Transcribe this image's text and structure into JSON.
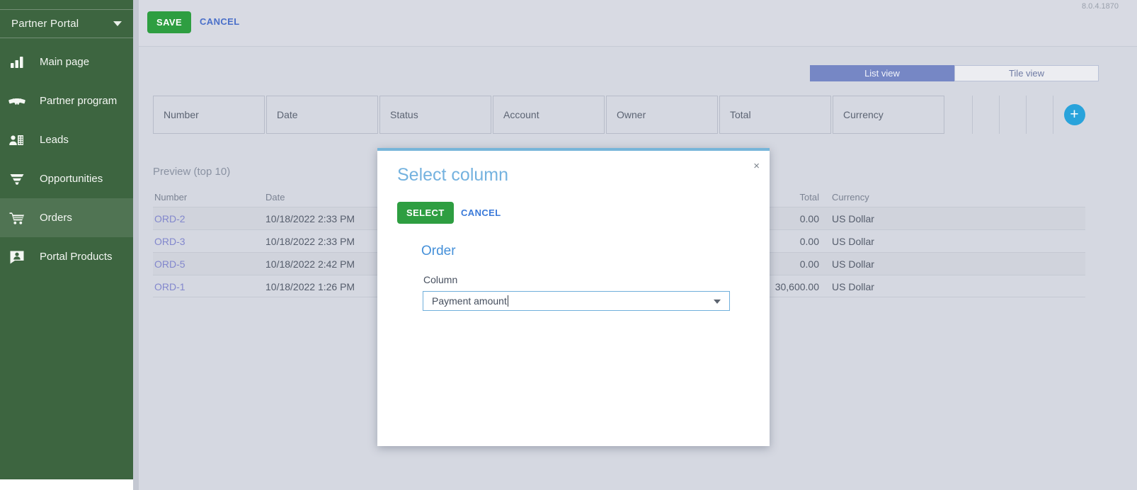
{
  "app": {
    "version": "8.0.4.1870"
  },
  "colors": {
    "sidebar_green": "#3d6540",
    "button_green": "#2e9e41",
    "link_blue": "#4a6fc9",
    "modal_accent_blue": "#74b2df",
    "toggle_active_blue": "#7687c5",
    "add_button_blue": "#29a3db",
    "content_background": "#d5d8e1"
  },
  "sidebar": {
    "workplace": "Partner Portal",
    "items": [
      {
        "label": "Main page",
        "icon": "bar-chart-icon"
      },
      {
        "label": "Partner program",
        "icon": "handshake-icon"
      },
      {
        "label": "Leads",
        "icon": "leads-icon"
      },
      {
        "label": "Opportunities",
        "icon": "funnel-icon"
      },
      {
        "label": "Orders",
        "icon": "cart-icon",
        "active": true
      },
      {
        "label": "Portal Products",
        "icon": "product-person-icon"
      }
    ]
  },
  "toolbar": {
    "save_label": "SAVE",
    "cancel_label": "CANCEL"
  },
  "view_toggle": {
    "list_label": "List view",
    "tile_label": "Tile view",
    "active": "List view"
  },
  "grid_setup": {
    "columns": [
      "Number",
      "Date",
      "Status",
      "Account",
      "Owner",
      "Total",
      "Currency"
    ],
    "add_button_glyph": "+"
  },
  "preview": {
    "title": "Preview (top 10)",
    "headers": {
      "number": "Number",
      "date": "Date",
      "total": "Total",
      "currency": "Currency"
    },
    "rows": [
      {
        "number": "ORD-2",
        "date": "10/18/2022 2:33 PM",
        "total": "0.00",
        "currency": "US Dollar"
      },
      {
        "number": "ORD-3",
        "date": "10/18/2022 2:33 PM",
        "total": "0.00",
        "currency": "US Dollar"
      },
      {
        "number": "ORD-5",
        "date": "10/18/2022 2:42 PM",
        "total": "0.00",
        "currency": "US Dollar"
      },
      {
        "number": "ORD-1",
        "date": "10/18/2022 1:26 PM",
        "total": "30,600.00",
        "currency": "US Dollar"
      }
    ]
  },
  "modal": {
    "title": "Select column",
    "select_label": "SELECT",
    "cancel_label": "CANCEL",
    "close_glyph": "×",
    "section_title": "Order",
    "field_label": "Column",
    "field_value": "Payment amount"
  }
}
